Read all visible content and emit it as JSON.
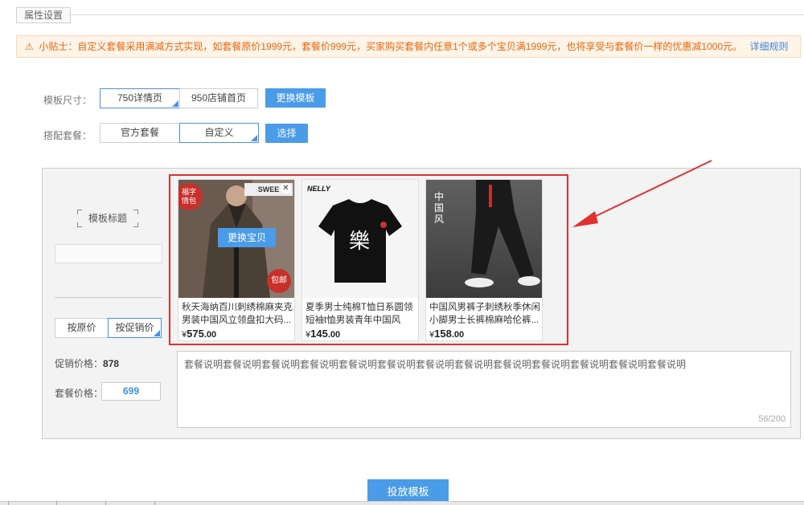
{
  "section": {
    "title": "属性设置"
  },
  "tip": {
    "icon": "warning-icon",
    "text": "小贴士：自定义套餐采用满减方式实现，如套餐原价1999元，套餐价999元，买家购买套餐内任意1个或多个宝贝满1999元，也将享受与套餐价一样的优惠减1000元。",
    "link": "详细规则"
  },
  "template_size": {
    "label": "模板尺寸：",
    "options": [
      "750详情页",
      "950店铺首页"
    ],
    "selected": "750详情页",
    "change_button": "更换模板"
  },
  "package": {
    "label": "搭配套餐：",
    "options": [
      "官方套餐",
      "自定义"
    ],
    "selected": "自定义",
    "select_button": "选择"
  },
  "left_panel": {
    "template_title": "模板标题",
    "price_toggle": {
      "options": [
        "按原价",
        "按促销价"
      ],
      "selected": "按促销价"
    },
    "promo_price_label": "促销价格：",
    "promo_price_value": "878",
    "package_price_label": "套餐价格：",
    "package_price_value": "699"
  },
  "products": [
    {
      "title": "秋天海纳百川刺绣棉麻夹克男装中国风立领盘扣大码...",
      "currency": "¥",
      "price_int": "575",
      "price_dec": ".00",
      "swap_label": "更换宝贝",
      "badge_top": "福字\n情包",
      "badge_bottom": "包邮",
      "banner": "SWEE"
    },
    {
      "title": "夏季男士纯棉T恤日系圆领短袖t恤男装青年中国风",
      "currency": "¥",
      "price_int": "145",
      "price_dec": ".00",
      "brand": "NELLY",
      "graphic": "樂"
    },
    {
      "title": "中国风男裤子刺绣秋季休闲小脚男士长裤棉麻哈伦裤...",
      "currency": "¥",
      "price_int": "158",
      "price_dec": ".00",
      "graphic": "中国风"
    }
  ],
  "description": {
    "text": "套餐说明套餐说明套餐说明套餐说明套餐说明套餐说明套餐说明套餐说明套餐说明套餐说明套餐说明套餐说明套餐说明",
    "count": "56/200"
  },
  "launch_button": "投放模板",
  "colors": {
    "accent": "#4a9be8",
    "highlight_border": "#e03030",
    "arrow": "#e03030",
    "tip_text": "#e4680f"
  }
}
